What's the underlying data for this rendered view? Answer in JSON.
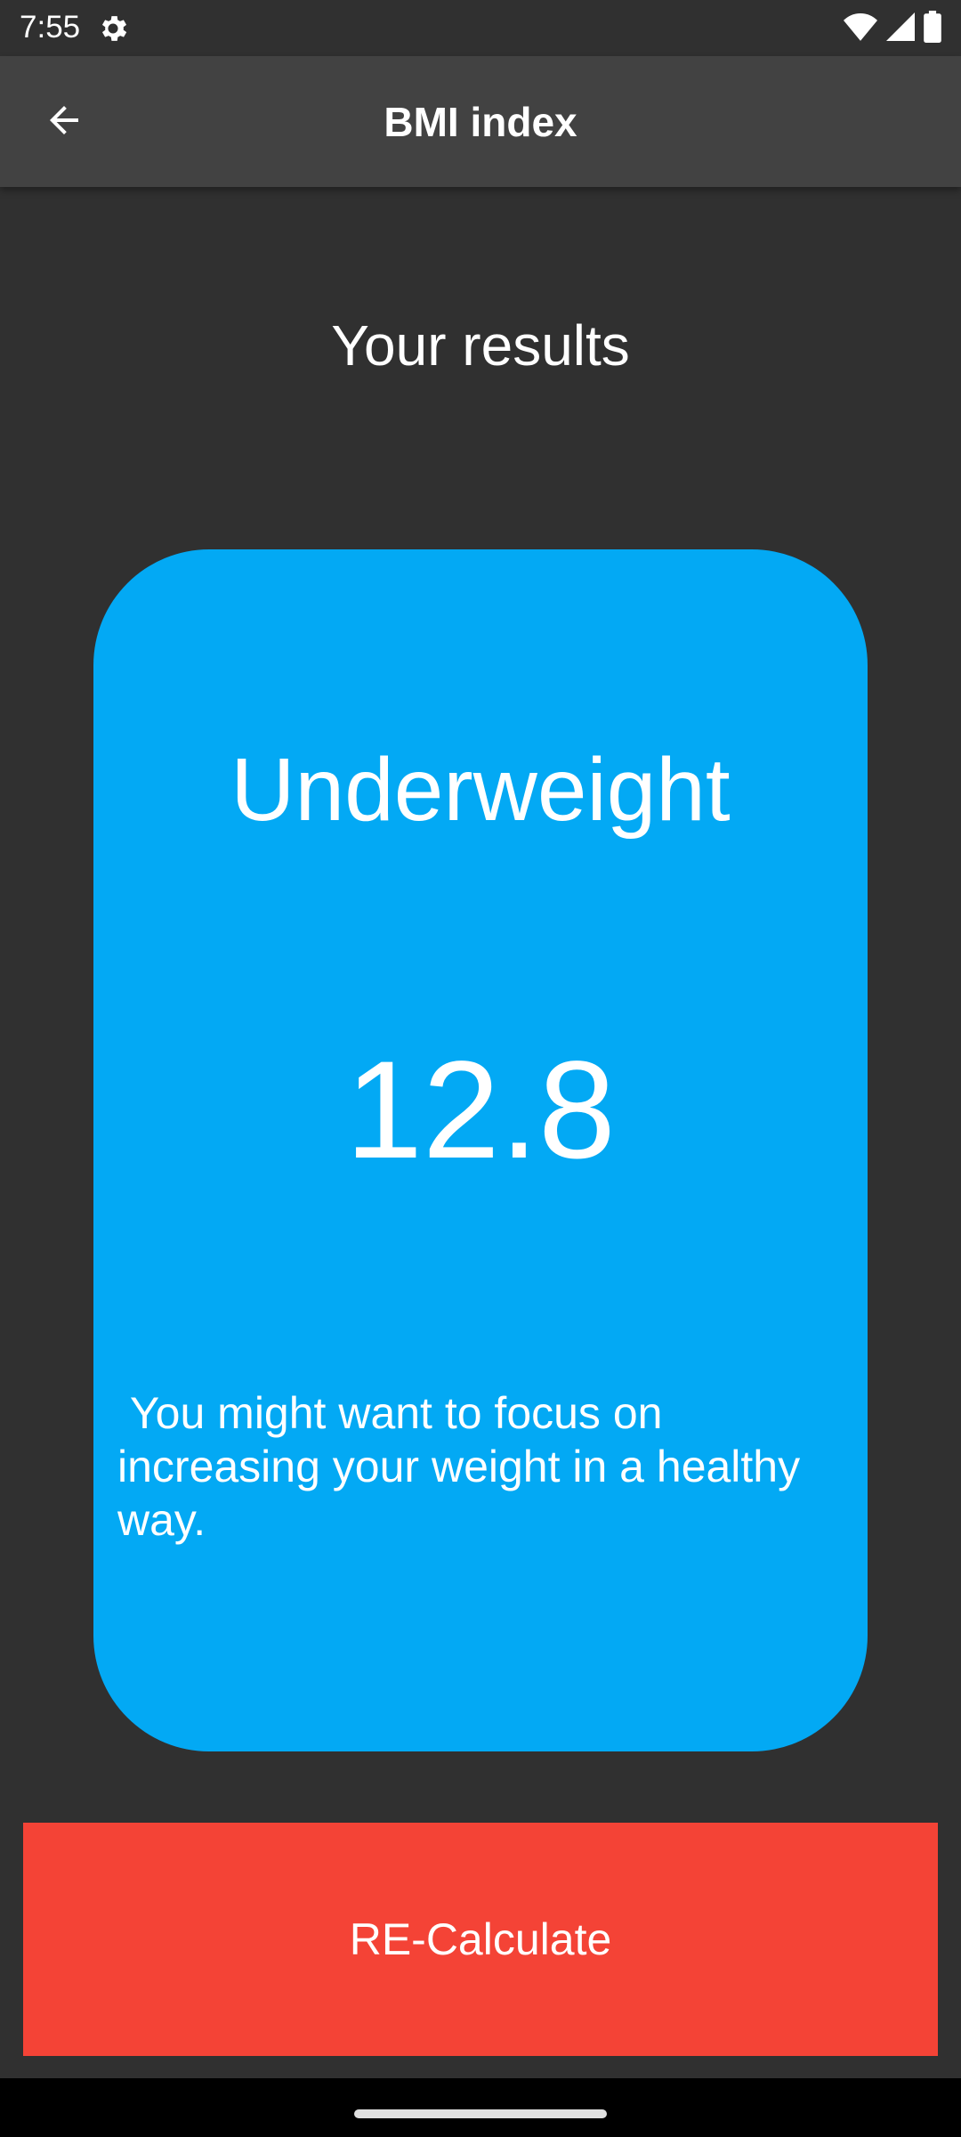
{
  "status_bar": {
    "time": "7:55",
    "icons": [
      "settings-gear-icon",
      "wifi-icon",
      "cell-signal-icon",
      "battery-icon"
    ]
  },
  "app_bar": {
    "title": "BMI index",
    "back_icon": "arrow-back-icon"
  },
  "results": {
    "heading": "Your results",
    "status": "Underweight",
    "bmi": "12.8",
    "advice": " You might want to focus on increasing your weight in a healthy way."
  },
  "actions": {
    "recalculate_label": "RE-Calculate"
  },
  "colors": {
    "background": "#303030",
    "app_bar": "#424242",
    "card": "#03a9f4",
    "button": "#f44336",
    "text": "#ffffff"
  }
}
